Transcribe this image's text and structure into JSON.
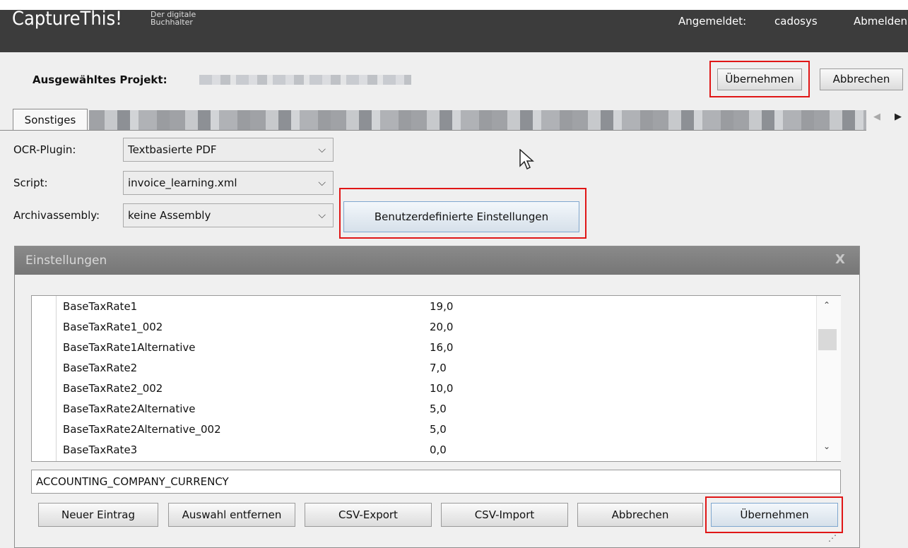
{
  "header": {
    "app_name": "CaptureThis!",
    "app_subtitle": "Der digitale Buchhalter",
    "logged_in_label": "Angemeldet:",
    "username": "cadosys",
    "logout": "Abmelden"
  },
  "project": {
    "label": "Ausgewähltes Projekt:",
    "apply": "Übernehmen",
    "cancel": "Abbrechen"
  },
  "tabs": {
    "active": "Sonstiges"
  },
  "form": {
    "ocr_label": "OCR-Plugin:",
    "ocr_value": "Textbasierte PDF",
    "script_label": "Script:",
    "script_value": "invoice_learning.xml",
    "archive_label": "Archivassembly:",
    "archive_value": "keine Assembly",
    "custom_settings": "Benutzerdefinierte Einstellungen"
  },
  "dialog": {
    "title": "Einstellungen",
    "close": "X",
    "rows": [
      {
        "key": "BaseTaxRate1",
        "value": "19,0"
      },
      {
        "key": "BaseTaxRate1_002",
        "value": "20,0"
      },
      {
        "key": "BaseTaxRate1Alternative",
        "value": "16,0"
      },
      {
        "key": "BaseTaxRate2",
        "value": "7,0"
      },
      {
        "key": "BaseTaxRate2_002",
        "value": "10,0"
      },
      {
        "key": "BaseTaxRate2Alternative",
        "value": "5,0"
      },
      {
        "key": "BaseTaxRate2Alternative_002",
        "value": "5,0"
      },
      {
        "key": "BaseTaxRate3",
        "value": "0,0"
      }
    ],
    "input_value": "ACCOUNTING_COMPANY_CURRENCY",
    "buttons": {
      "new_entry": "Neuer Eintrag",
      "remove": "Auswahl entfernen",
      "csv_export": "CSV-Export",
      "csv_import": "CSV-Import",
      "cancel": "Abbrechen",
      "apply": "Übernehmen"
    }
  },
  "colors": {
    "header_bg": "#3c3c3c",
    "highlight": "#e01616"
  }
}
